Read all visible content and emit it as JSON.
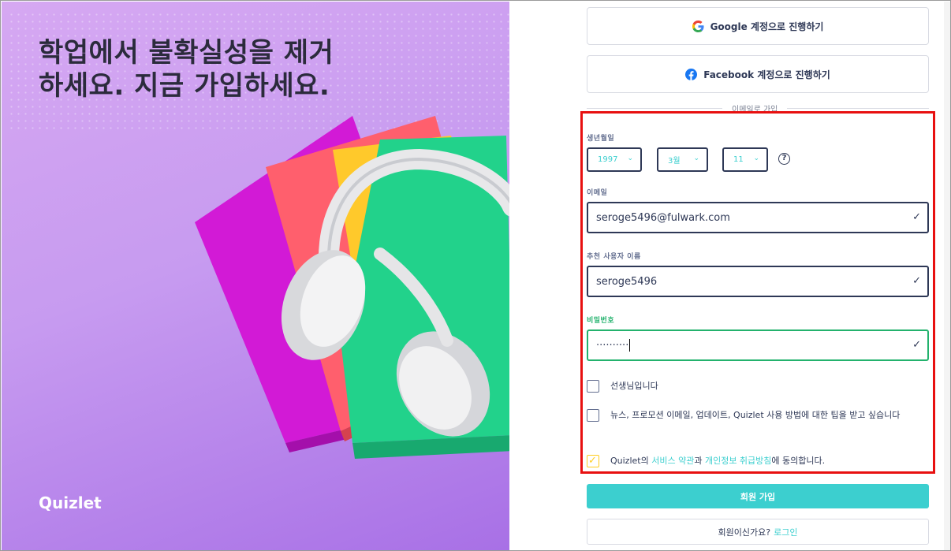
{
  "hero": {
    "headline": "학업에서 불확실성을 제거하세요. 지금 가입하세요.",
    "logo": "Quizlet"
  },
  "social": {
    "google_label": "Google 계정으로 진행하기",
    "facebook_label": "Facebook 계정으로 진행하기",
    "divider_text": "이메일로 가입"
  },
  "form": {
    "birthday_label": "생년월일",
    "year": "1997",
    "month": "3월",
    "day": "11",
    "help_icon": "?",
    "email_label": "이메일",
    "email_value": "seroge5496@fulwark.com",
    "username_label": "추천 사용자 이름",
    "username_value": "seroge5496",
    "password_label": "비밀번호",
    "password_value": "··········",
    "teacher_label": "선생님입니다",
    "newsletter_label": "뉴스, 프로모션 이메일, 업데이트, Quizlet 사용 방법에 대한 팁을 받고 싶습니다",
    "terms_prefix": "Quizlet의 ",
    "terms_link": "서비스 약관",
    "terms_mid": "과 ",
    "privacy_link": "개인정보 취급방침",
    "terms_suffix": "에 동의합니다."
  },
  "actions": {
    "signup_label": "회원 가입",
    "have_account": "회원이신가요?",
    "login_link": "로그인"
  },
  "colors": {
    "accent": "#3ccfcf",
    "valid_border": "#23b26d",
    "highlight_box": "#e81010"
  }
}
